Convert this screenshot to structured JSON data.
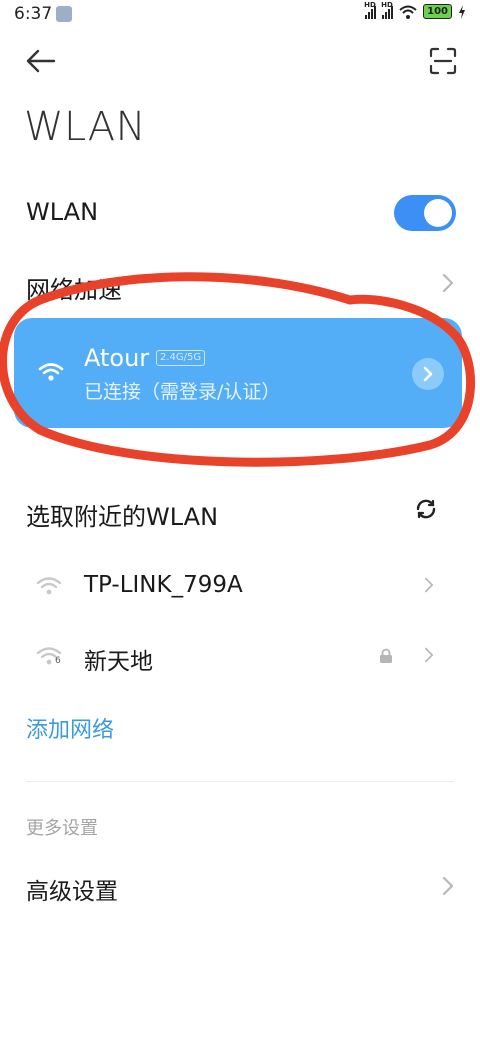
{
  "status_bar": {
    "time": "6:37",
    "sim1_label": "HD",
    "sim2_label": "HD",
    "battery": "100"
  },
  "header": {
    "back_icon": "back-arrow-icon",
    "scan_icon": "scan-qr-icon",
    "title": "WLAN"
  },
  "wlan_toggle": {
    "label": "WLAN",
    "enabled": true,
    "accent": "#3c8ff5"
  },
  "network_acceleration": {
    "label": "网络加速"
  },
  "connected_network": {
    "ssid": "Atour",
    "band": "2.4G/5G",
    "status": "已连接（需登录/认证）",
    "card_color": "#54aef7"
  },
  "nearby": {
    "header": "选取附近的WLAN",
    "networks": [
      {
        "name": "TP-LINK_799A",
        "secured": false,
        "wifi_badge": ""
      },
      {
        "name": "新天地",
        "secured": true,
        "wifi_badge": "6"
      }
    ]
  },
  "add_network": {
    "label": "添加网络",
    "color": "#3c9ade"
  },
  "more_settings": {
    "header": "更多设置",
    "items": [
      {
        "label": "高级设置"
      }
    ]
  },
  "annotation_color": "#e8432a"
}
